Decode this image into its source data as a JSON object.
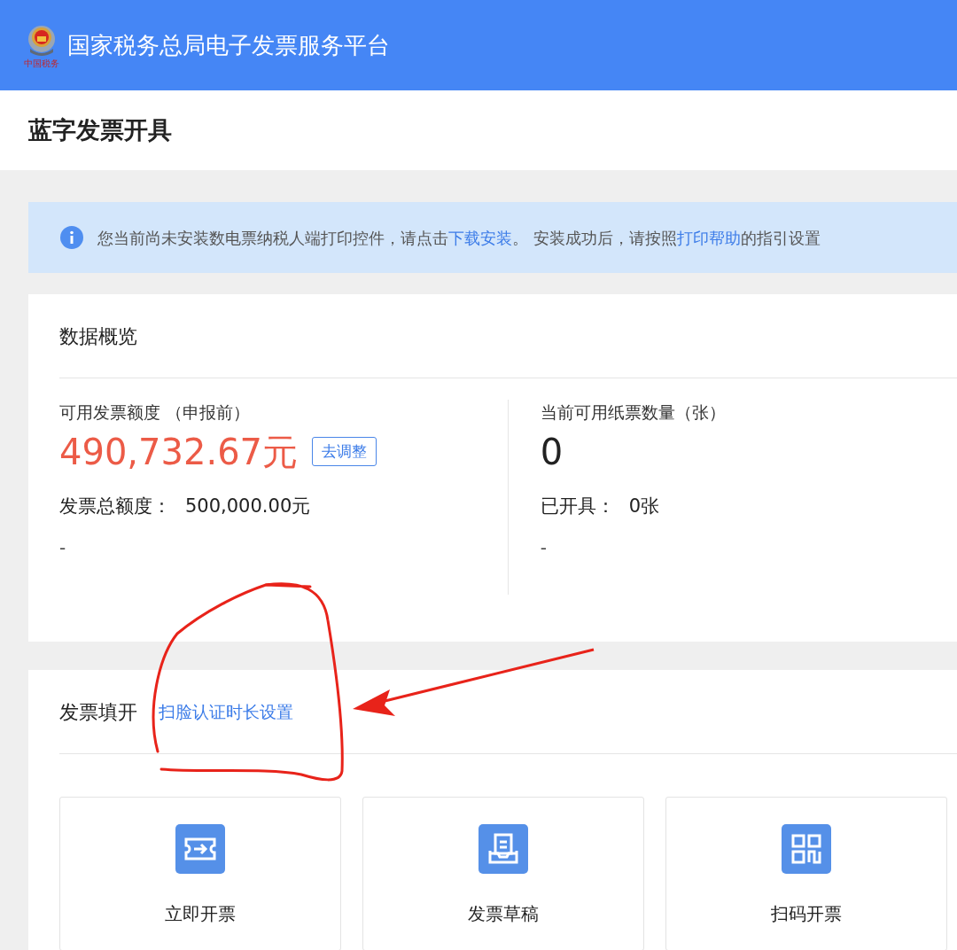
{
  "header": {
    "logo_caption": "中国税务",
    "title": "国家税务总局电子发票服务平台"
  },
  "page_title": "蓝字发票开具",
  "alert": {
    "segments": [
      {
        "kind": "text",
        "text": "您当前尚未安装数电票纳税人端打印控件，请点击"
      },
      {
        "kind": "link",
        "text": "下载安装"
      },
      {
        "kind": "text",
        "text": "。 安装成功后，请按照"
      },
      {
        "kind": "link",
        "text": "打印帮助"
      },
      {
        "kind": "text",
        "text": "的指引设置"
      }
    ]
  },
  "overview": {
    "title": "数据概览",
    "stats": [
      {
        "label": "可用发票额度 （申报前）",
        "value": "490,732.67元",
        "color": "#ec5b47",
        "action": "去调整",
        "detail_label": "发票总额度：",
        "detail_value": "500,000.00元",
        "note": "-"
      },
      {
        "label": "当前可用纸票数量（张）",
        "value": "0",
        "color": "#222222",
        "detail_label": "已开具：",
        "detail_value": "0张",
        "note": "-"
      }
    ]
  },
  "issue": {
    "title": "发票填开",
    "link": "扫脸认证时长设置",
    "tiles": [
      {
        "kind": "ticket",
        "label": "立即开票"
      },
      {
        "kind": "draft",
        "label": "发票草稿"
      },
      {
        "kind": "qr",
        "label": "扫码开票"
      }
    ]
  }
}
